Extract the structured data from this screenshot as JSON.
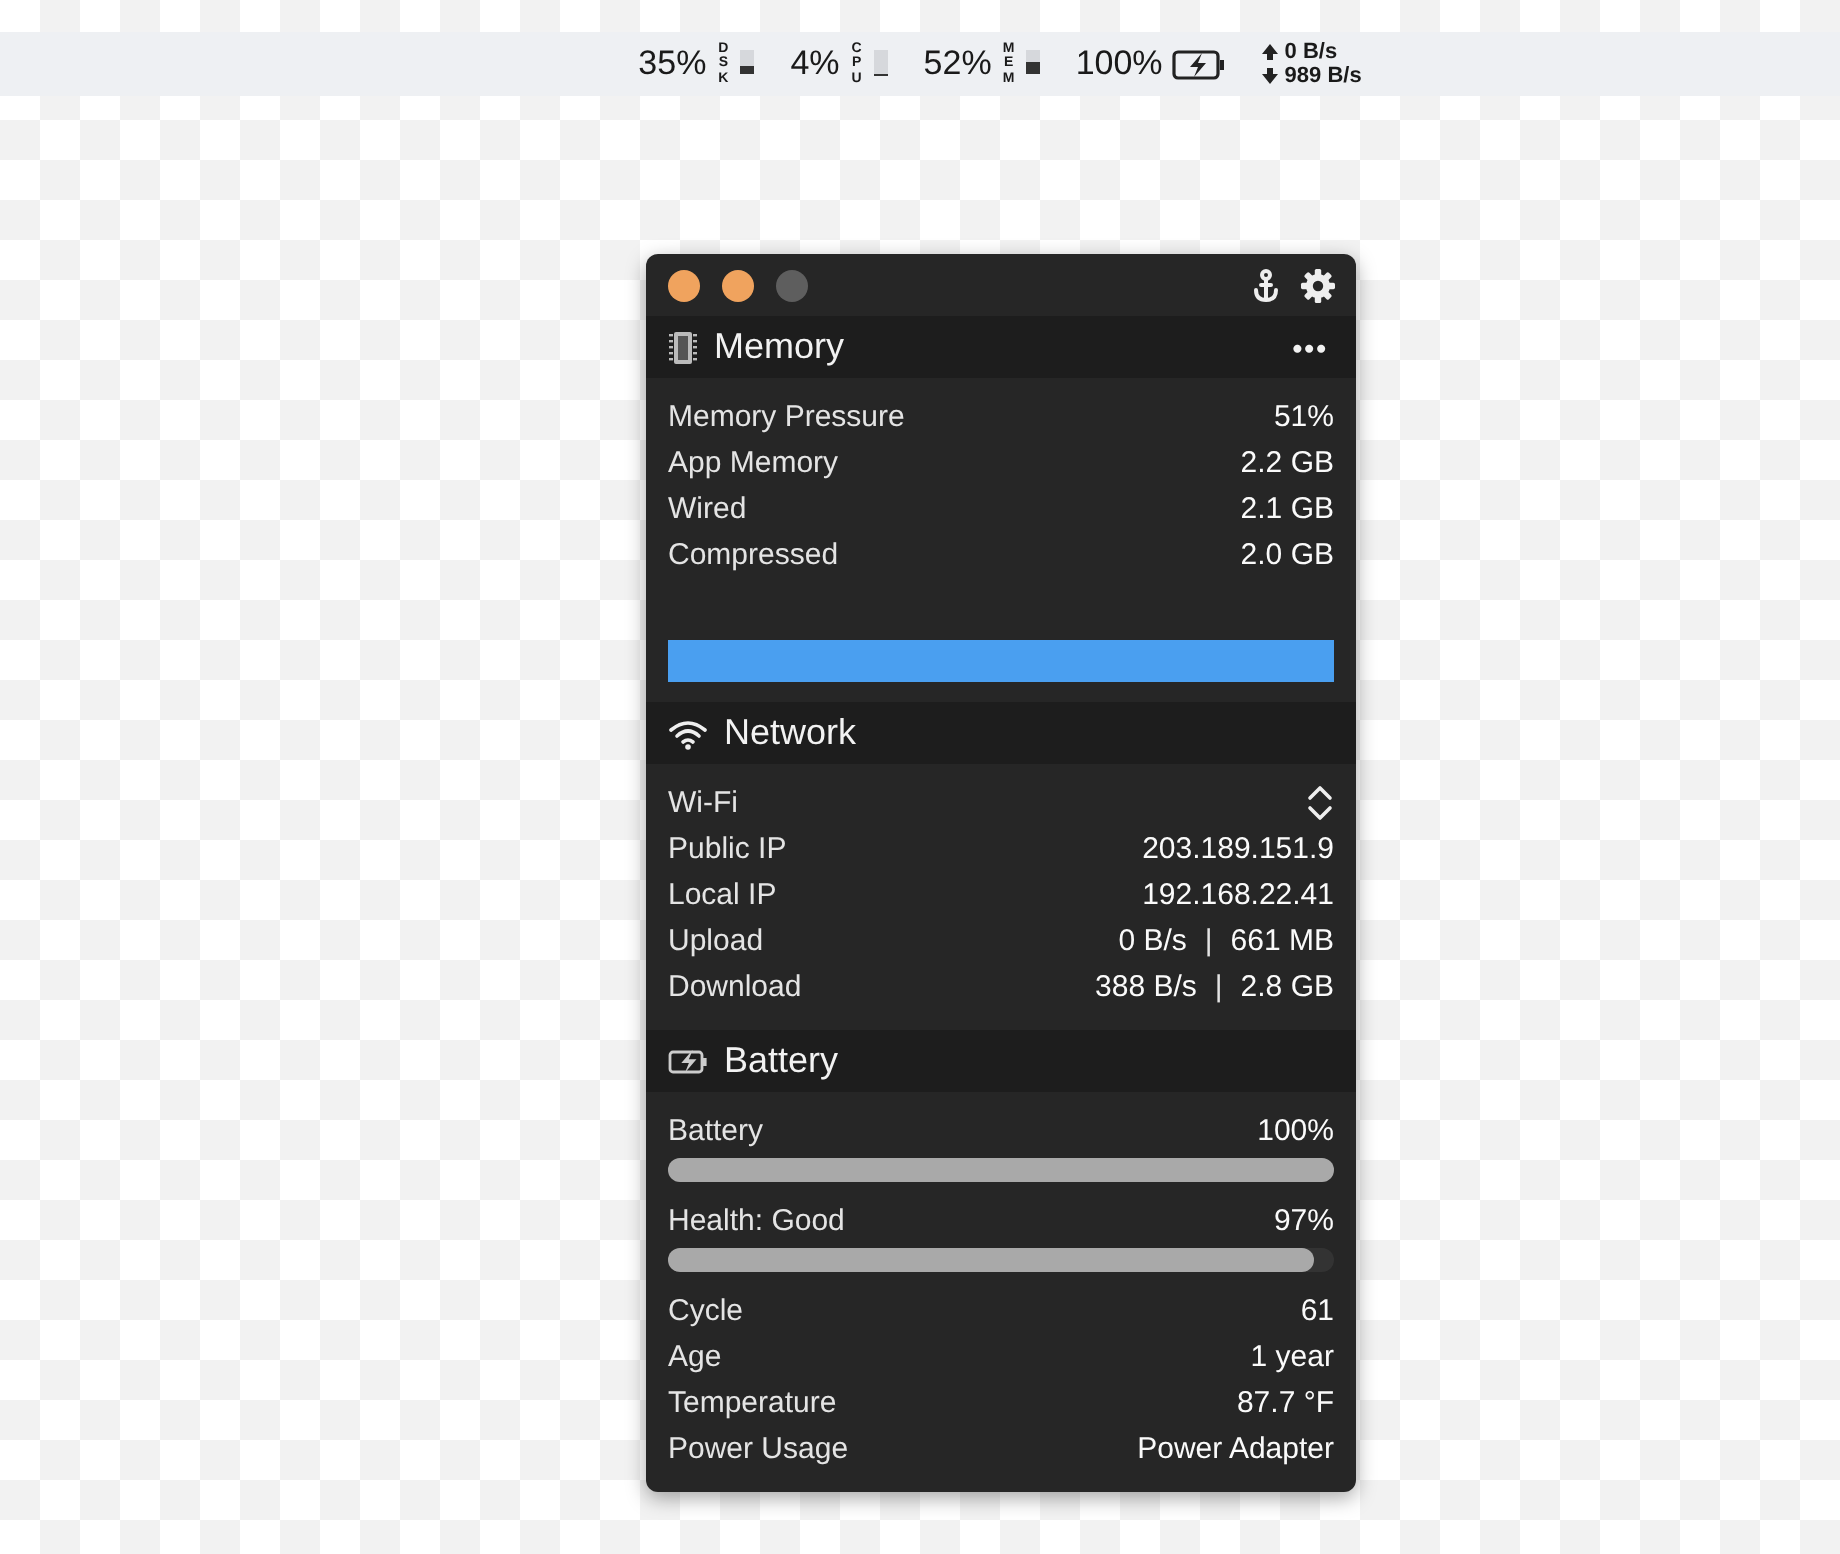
{
  "menu_bar": {
    "items": [
      {
        "kind": "meter",
        "value": "35%",
        "label": "DSK",
        "level": 0.35
      },
      {
        "kind": "meter",
        "value": "4%",
        "label": "CPU",
        "level": 0.04
      },
      {
        "kind": "meter",
        "value": "52%",
        "label": "MEM",
        "level": 0.52
      },
      {
        "kind": "battery",
        "value": "100%",
        "charging": true
      },
      {
        "kind": "network",
        "upload": "0 B/s",
        "download": "989 B/s"
      }
    ]
  },
  "window": {
    "traffic_lights": [
      {
        "color": "#f0a35e"
      },
      {
        "color": "#f0a35e"
      },
      {
        "color": "#5e5e5e"
      }
    ]
  },
  "sections": [
    {
      "kind": "memory",
      "title": "Memory",
      "menu": "•••",
      "rows": [
        {
          "kind": "pair",
          "label": "Memory Pressure",
          "value": "51%"
        },
        {
          "kind": "pair",
          "label": "App Memory",
          "value": "2.2 GB"
        },
        {
          "kind": "pair",
          "label": "Wired",
          "value": "2.1 GB"
        },
        {
          "kind": "pair",
          "label": "Compressed",
          "value": "2.0 GB"
        },
        {
          "kind": "graph"
        }
      ]
    },
    {
      "kind": "network",
      "title": "Network",
      "rows": [
        {
          "kind": "select",
          "label": "Wi-Fi"
        },
        {
          "kind": "pair",
          "label": "Public IP",
          "value": "203.189.151.9"
        },
        {
          "kind": "pair",
          "label": "Local IP",
          "value": "192.168.22.41"
        },
        {
          "kind": "transfer",
          "label": "Upload",
          "rate": "0 B/s",
          "separator": "|",
          "total": "661 MB"
        },
        {
          "kind": "transfer",
          "label": "Download",
          "rate": "388 B/s",
          "separator": "|",
          "total": "2.8 GB"
        }
      ]
    },
    {
      "kind": "battery",
      "title": "Battery",
      "rows": [
        {
          "kind": "meter",
          "label": "Battery",
          "value": "100%",
          "level": 1.0
        },
        {
          "kind": "meter",
          "label": "Health: Good",
          "value": "97%",
          "level": 0.97
        },
        {
          "kind": "pair",
          "label": "Cycle",
          "value": "61"
        },
        {
          "kind": "pair",
          "label": "Age",
          "value": "1 year"
        },
        {
          "kind": "pair",
          "label": "Temperature",
          "value": "87.7 °F"
        },
        {
          "kind": "pair",
          "label": "Power Usage",
          "value": "Power Adapter"
        }
      ]
    }
  ]
}
